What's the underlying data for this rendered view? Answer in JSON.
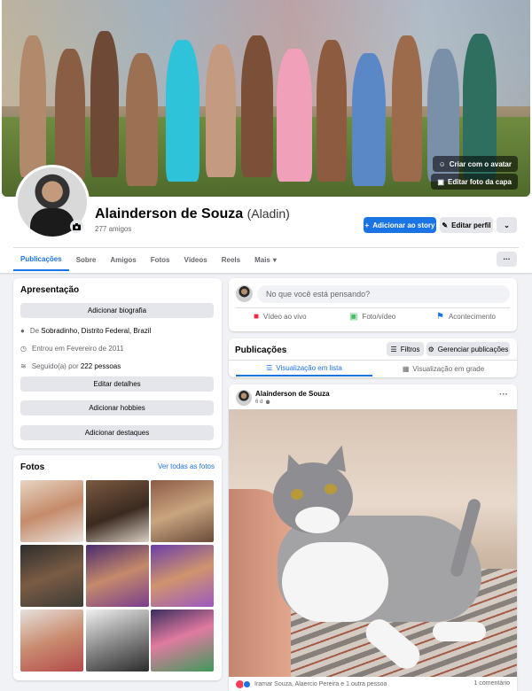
{
  "cover": {
    "create_avatar_label": "Criar com o avatar",
    "edit_cover_label": "Editar foto da capa"
  },
  "profile": {
    "name": "Alainderson de Souza",
    "alt_name": "(Aladin)",
    "friends_count": "277 amigos"
  },
  "actions": {
    "add_story": "Adicionar ao story",
    "edit_profile": "Editar perfil"
  },
  "tabs": [
    "Publicações",
    "Sobre",
    "Amigos",
    "Fotos",
    "Vídeos",
    "Reels",
    "Mais"
  ],
  "intro": {
    "title": "Apresentação",
    "add_bio": "Adicionar biografia",
    "location_prefix": "De ",
    "location": "Sobradinho, Distrito Federal, Brazil",
    "joined": "Entrou em Fevereiro de 2011",
    "followed_prefix": "Seguido(a) por ",
    "followers": "222 pessoas",
    "edit_details": "Editar detalhes",
    "add_hobbies": "Adicionar hobbies",
    "add_highlights": "Adicionar destaques"
  },
  "photos": {
    "title": "Fotos",
    "see_all": "Ver todas as fotos"
  },
  "composer": {
    "placeholder": "No que você está pensando?",
    "live_video": "Vídeo ao vivo",
    "photo_video": "Foto/vídeo",
    "life_event": "Acontecimento"
  },
  "posts_header": {
    "title": "Publicações",
    "filters": "Filtros",
    "manage": "Gerenciar publicações",
    "list_view": "Visualização em lista",
    "grid_view": "Visualização em grade"
  },
  "post": {
    "author": "Alainderson de Souza",
    "time": "6 d",
    "reactions_text": "Iramar Souza, Alaercio Pereira e 1 outra pessoa",
    "comments": "1 comentário"
  },
  "colors": {
    "accent": "#1b74e4",
    "background": "#f0f2f5"
  }
}
